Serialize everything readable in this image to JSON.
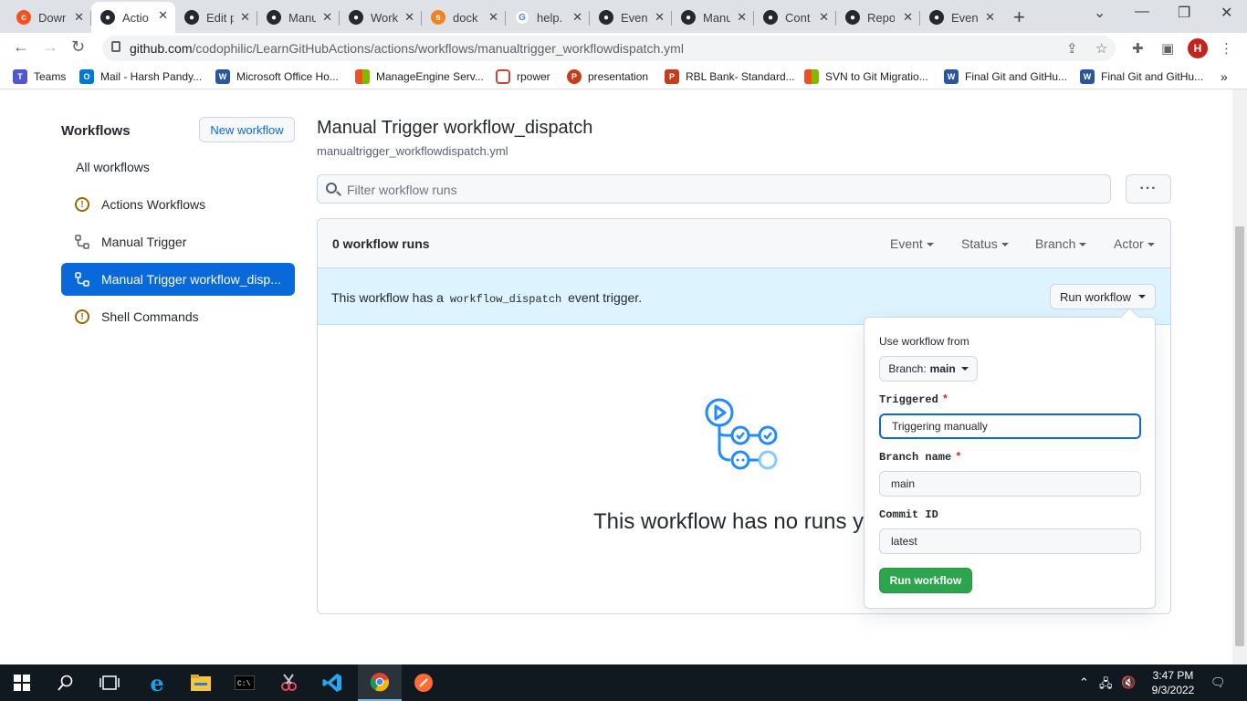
{
  "browser": {
    "tabs": [
      {
        "label": "Down",
        "favicon": "codophilic-icon"
      },
      {
        "label": "Actio",
        "favicon": "github-icon"
      },
      {
        "label": "Edit p",
        "favicon": "github-icon"
      },
      {
        "label": "Manu",
        "favicon": "github-icon"
      },
      {
        "label": "Work",
        "favicon": "github-icon"
      },
      {
        "label": "dock",
        "favicon": "stackoverflow-icon"
      },
      {
        "label": "help.",
        "favicon": "google-icon"
      },
      {
        "label": "Even",
        "favicon": "github-icon"
      },
      {
        "label": "Manu",
        "favicon": "github-icon"
      },
      {
        "label": "Cont",
        "favicon": "github-icon"
      },
      {
        "label": "Repo",
        "favicon": "github-icon"
      },
      {
        "label": "Even",
        "favicon": "github-icon"
      }
    ],
    "url_host": "github.com",
    "url_path": "/codophilic/LearnGitHubActions/actions/workflows/manualtrigger_workflowdispatch.yml",
    "profile_initial": "H",
    "bookmarks": [
      {
        "label": "Teams"
      },
      {
        "label": "Mail - Harsh Pandy..."
      },
      {
        "label": "Microsoft Office Ho..."
      },
      {
        "label": "ManageEngine Serv..."
      },
      {
        "label": "rpower"
      },
      {
        "label": "presentation"
      },
      {
        "label": "RBL Bank- Standard..."
      },
      {
        "label": "SVN to Git Migratio..."
      },
      {
        "label": "Final Git and GitHu..."
      },
      {
        "label": "Final Git and GitHu..."
      }
    ]
  },
  "sidebar": {
    "title": "Workflows",
    "new_button": "New workflow",
    "items": [
      {
        "label": "All workflows",
        "icon": ""
      },
      {
        "label": "Actions Workflows",
        "icon": "warning-icon"
      },
      {
        "label": "Manual Trigger",
        "icon": "workflow-icon"
      },
      {
        "label": "Manual Trigger workflow_disp...",
        "icon": "workflow-icon"
      },
      {
        "label": "Shell Commands",
        "icon": "warning-icon"
      }
    ]
  },
  "main": {
    "title": "Manual Trigger workflow_dispatch",
    "filename": "manualtrigger_workflowdispatch.yml",
    "filter_placeholder": "Filter workflow runs",
    "kebab": "···",
    "runs_count": "0 workflow runs",
    "filters": [
      "Event",
      "Status",
      "Branch",
      "Actor"
    ],
    "banner_prefix": "This workflow has a",
    "banner_code": "workflow_dispatch",
    "banner_suffix": "event trigger.",
    "run_workflow_button": "Run workflow",
    "empty_title": "This workflow has no runs y"
  },
  "popover": {
    "use_from_label": "Use workflow from",
    "branch_prefix": "Branch:",
    "branch_value": "main",
    "fields": [
      {
        "label": "Triggered",
        "required": "*",
        "value": "Triggering manually"
      },
      {
        "label": "Branch name",
        "required": "*",
        "value": "main"
      },
      {
        "label": "Commit ID",
        "required": "",
        "value": "latest"
      }
    ],
    "submit": "Run workflow"
  },
  "taskbar": {
    "time": "3:47 PM",
    "date": "9/3/2022"
  },
  "colors": {
    "primary": "#0969da",
    "success": "#2da44e",
    "banner": "#ddf4ff",
    "taskbar": "#101820"
  }
}
